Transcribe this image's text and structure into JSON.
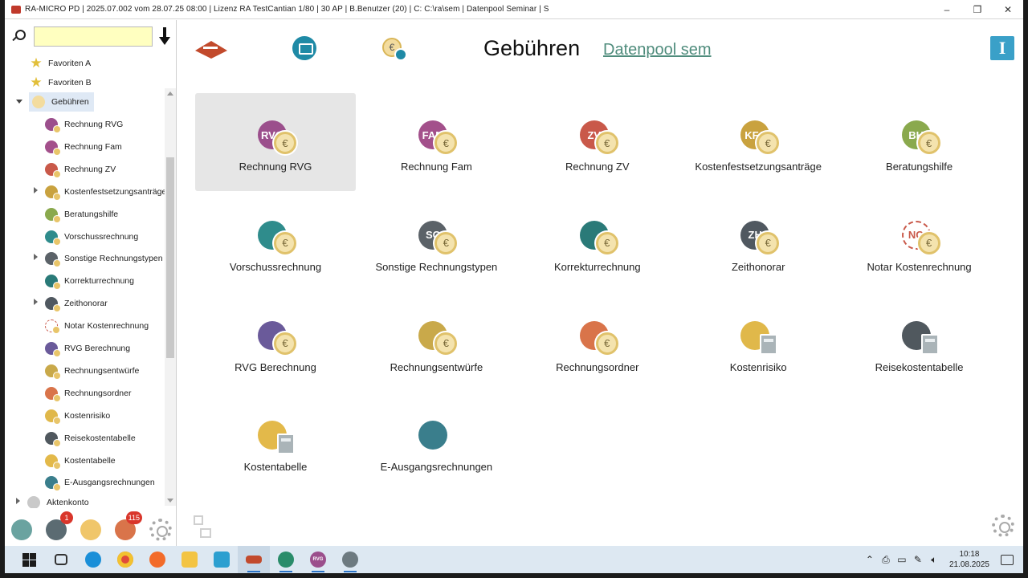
{
  "window": {
    "title": "RA-MICRO PD | 2025.07.002 vom 28.07.25 08:00 | Lizenz RA TestCantian  1/80 | 30 AP | B.Benutzer (20) | C: C:\\ra\\sem | Datenpool Seminar | S",
    "minimize": "–",
    "restore": "❐",
    "close": "✕"
  },
  "search": {
    "value": "",
    "placeholder": ""
  },
  "tree": {
    "favorites_a": "Favoriten A",
    "favorites_b": "Favoriten B",
    "root": "Gebühren",
    "items": [
      "Rechnung RVG",
      "Rechnung Fam",
      "Rechnung ZV",
      "Kostenfestsetzungsanträge",
      "Beratungshilfe",
      "Vorschussrechnung",
      "Sonstige Rechnungstypen",
      "Korrekturrechnung",
      "Zeithonorar",
      "Notar Kostenrechnung",
      "RVG Berechnung",
      "Rechnungsentwürfe",
      "Rechnungsordner",
      "Kostenrisiko",
      "Reisekostentabelle",
      "Kostentabelle",
      "E-Ausgangsrechnungen"
    ],
    "next_root": "Aktenkonto"
  },
  "bottom_badges": {
    "messages": "1",
    "tasks": "115"
  },
  "header": {
    "title": "Gebühren",
    "pool_link": "Datenpool sem",
    "info": "I",
    "euro": "€"
  },
  "tiles": [
    {
      "label": "Rechnung RVG",
      "abbr": "RVG",
      "color": "#9b4f8c"
    },
    {
      "label": "Rechnung Fam",
      "abbr": "FAM",
      "color": "#a3508b"
    },
    {
      "label": "Rechnung ZV",
      "abbr": "ZV",
      "color": "#c9594a"
    },
    {
      "label": "Kostenfestsetzungsanträge",
      "abbr": "KFA",
      "color": "#c9a23f"
    },
    {
      "label": "Beratungshilfe",
      "abbr": "BH",
      "color": "#8aa94d"
    },
    {
      "label": "Vorschussrechnung",
      "abbr": "",
      "color": "#2f8c8c"
    },
    {
      "label": "Sonstige Rechnungstypen",
      "abbr": "SO",
      "color": "#5b6268"
    },
    {
      "label": "Korrekturrechnung",
      "abbr": "",
      "color": "#2a7a78"
    },
    {
      "label": "Zeithonorar",
      "abbr": "ZH",
      "color": "#505860"
    },
    {
      "label": "Notar Kostenrechnung",
      "abbr": "NO",
      "color": "#ffffff"
    },
    {
      "label": "RVG Berechnung",
      "abbr": "",
      "color": "#6a5a9a"
    },
    {
      "label": "Rechnungsentwürfe",
      "abbr": "",
      "color": "#c9a94a"
    },
    {
      "label": "Rechnungsordner",
      "abbr": "",
      "color": "#d9744a"
    },
    {
      "label": "Kostenrisiko",
      "abbr": "",
      "color": "#e0b84a"
    },
    {
      "label": "Reisekostentabelle",
      "abbr": "",
      "color": "#50585e"
    },
    {
      "label": "Kostentabelle",
      "abbr": "",
      "color": "#e3b94a"
    },
    {
      "label": "E-Ausgangsrechnungen",
      "abbr": "",
      "color": "#3a7e8c"
    }
  ],
  "taskbar": {
    "time": "10:18",
    "date": "21.08.2025",
    "active_app_label": "RVG"
  }
}
